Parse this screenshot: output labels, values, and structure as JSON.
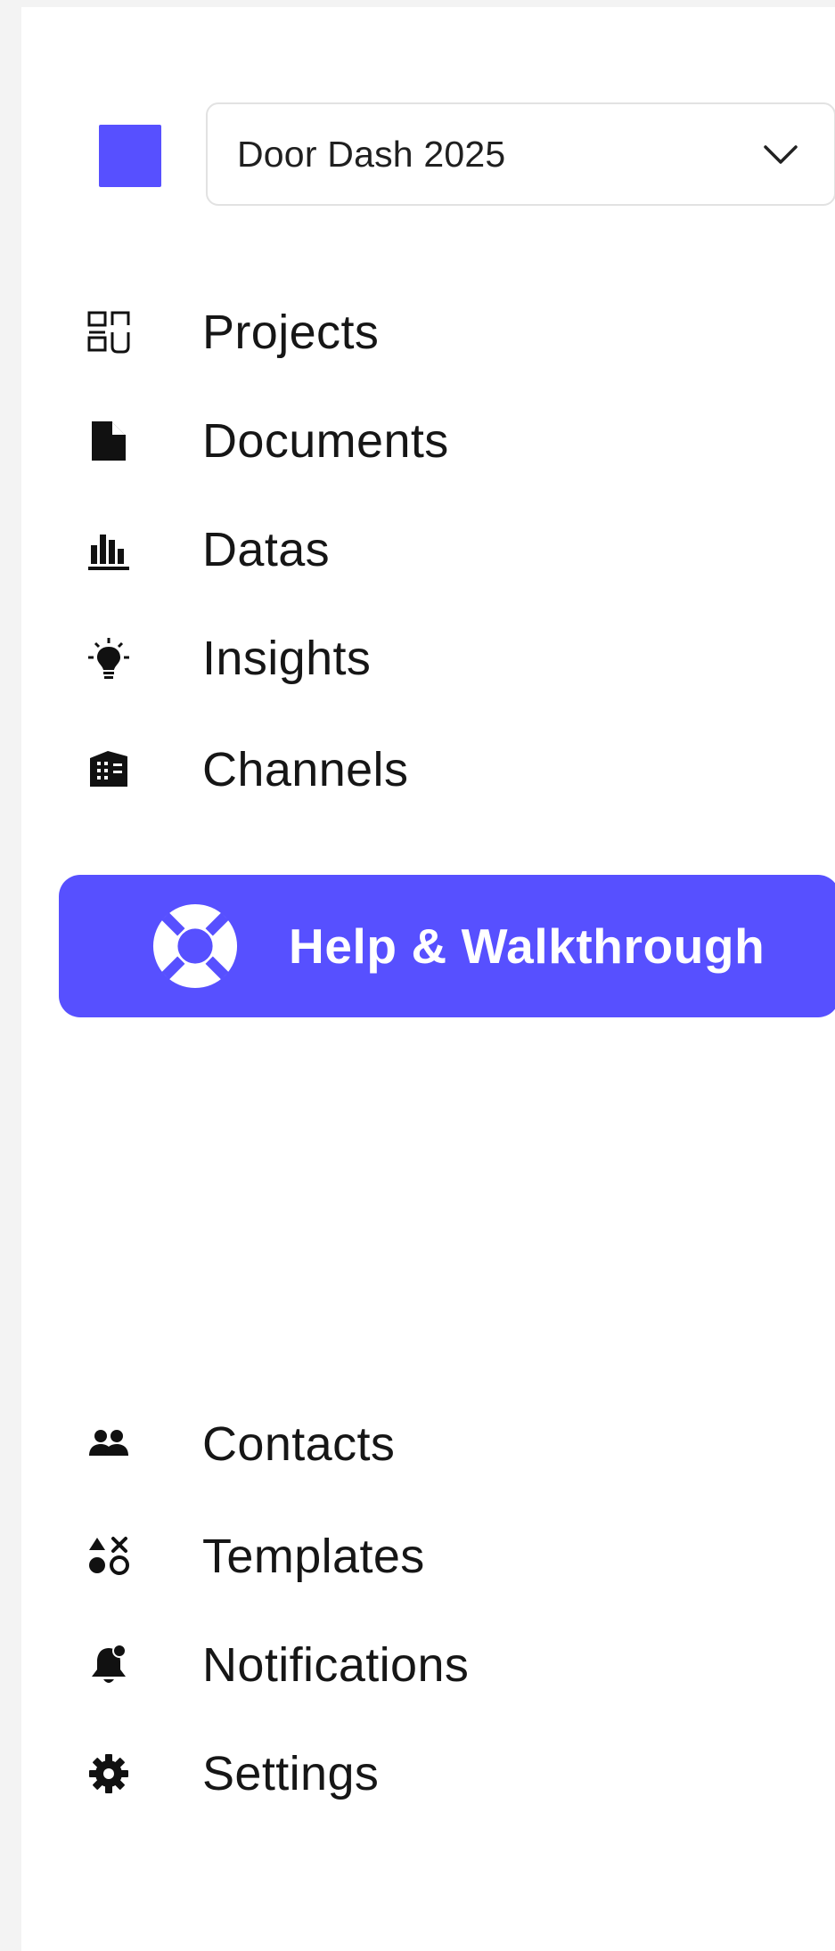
{
  "workspace": {
    "selected": "Door Dash 2025",
    "color": "#5750ff"
  },
  "nav_primary": [
    {
      "label": "Projects",
      "icon": "projects-grid-icon"
    },
    {
      "label": "Documents",
      "icon": "document-icon"
    },
    {
      "label": "Datas",
      "icon": "bar-chart-icon"
    },
    {
      "label": "Insights",
      "icon": "lightbulb-icon"
    },
    {
      "label": "Channels",
      "icon": "building-icon"
    }
  ],
  "help": {
    "label": "Help & Walkthrough",
    "icon": "life-ring-icon"
  },
  "nav_secondary": [
    {
      "label": "Contacts",
      "icon": "users-icon"
    },
    {
      "label": "Templates",
      "icon": "shapes-icon"
    },
    {
      "label": "Notifications",
      "icon": "bell-icon"
    },
    {
      "label": "Settings",
      "icon": "gear-icon"
    }
  ],
  "colors": {
    "accent": "#5750ff",
    "text": "#161616",
    "border": "#e2e2e2",
    "background": "#ffffff"
  }
}
